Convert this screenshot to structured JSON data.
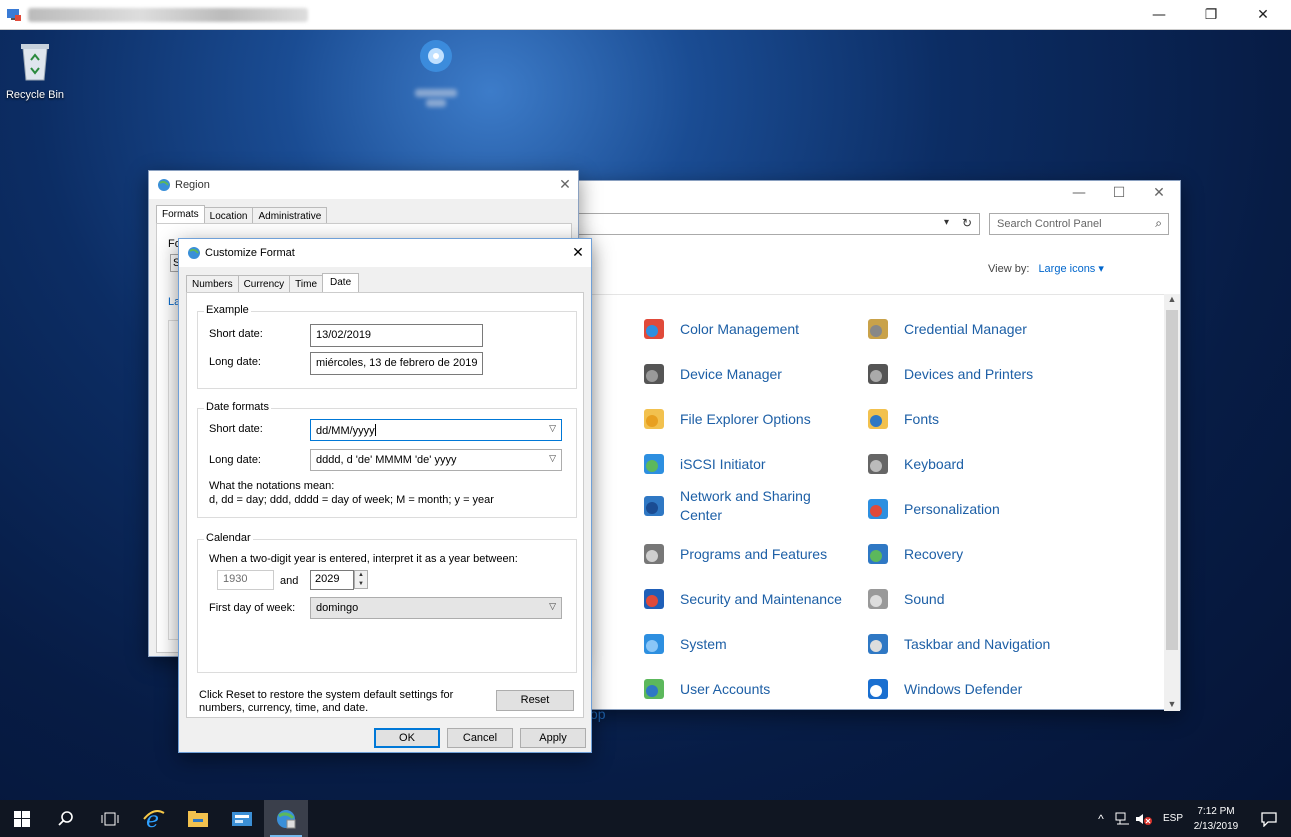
{
  "rdp": {
    "min": "—",
    "max": "❐",
    "close": "✕"
  },
  "desktop": {
    "recycle_bin": "Recycle Bin"
  },
  "control_panel": {
    "search_placeholder": "Search Control Panel",
    "view_by_label": "View by:",
    "view_by_value": "Large icons",
    "stray_text": "op",
    "items_left": [
      "Color Management",
      "Device Manager",
      "File Explorer Options",
      "iSCSI Initiator",
      "Network and Sharing Center",
      "Programs and Features",
      "Security and Maintenance",
      "System",
      "User Accounts"
    ],
    "items_right": [
      "Credential Manager",
      "Devices and Printers",
      "Fonts",
      "Keyboard",
      "Personalization",
      "Recovery",
      "Sound",
      "Taskbar and Navigation",
      "Windows Defender"
    ]
  },
  "region": {
    "title": "Region",
    "tabs": [
      "Formats",
      "Location",
      "Administrative"
    ],
    "frag_fo": "Fo",
    "frag_s": "S",
    "frag_la": "La"
  },
  "customize": {
    "title": "Customize Format",
    "tabs": [
      "Numbers",
      "Currency",
      "Time",
      "Date"
    ],
    "example": {
      "heading": "Example",
      "short_label": "Short date:",
      "short_value": "13/02/2019",
      "long_label": "Long date:",
      "long_value": "miércoles, 13 de febrero de 2019"
    },
    "formats": {
      "heading": "Date formats",
      "short_label": "Short date:",
      "short_value": "dd/MM/yyyy",
      "long_label": "Long date:",
      "long_value": "dddd, d 'de' MMMM 'de' yyyy",
      "notation_title": "What the notations mean:",
      "notation_text": "d, dd = day;  ddd, dddd = day of week;  M = month;  y = year"
    },
    "calendar": {
      "heading": "Calendar",
      "two_digit_text": "When a two-digit year is entered, interpret it as a year between:",
      "year_from": "1930",
      "and_label": "and",
      "year_to": "2029",
      "first_day_label": "First day of week:",
      "first_day_value": "domingo"
    },
    "reset_text": "Click Reset to restore the system default settings for numbers, currency, time, and date.",
    "reset_button": "Reset",
    "ok_button": "OK",
    "cancel_button": "Cancel",
    "apply_button": "Apply"
  },
  "taskbar": {
    "lang": "ESP",
    "time": "7:12 PM",
    "date": "2/13/2019"
  },
  "colors": {
    "link": "#1d5fa6",
    "accent": "#0078d7",
    "annotation_arrow": "#e04a3a"
  }
}
